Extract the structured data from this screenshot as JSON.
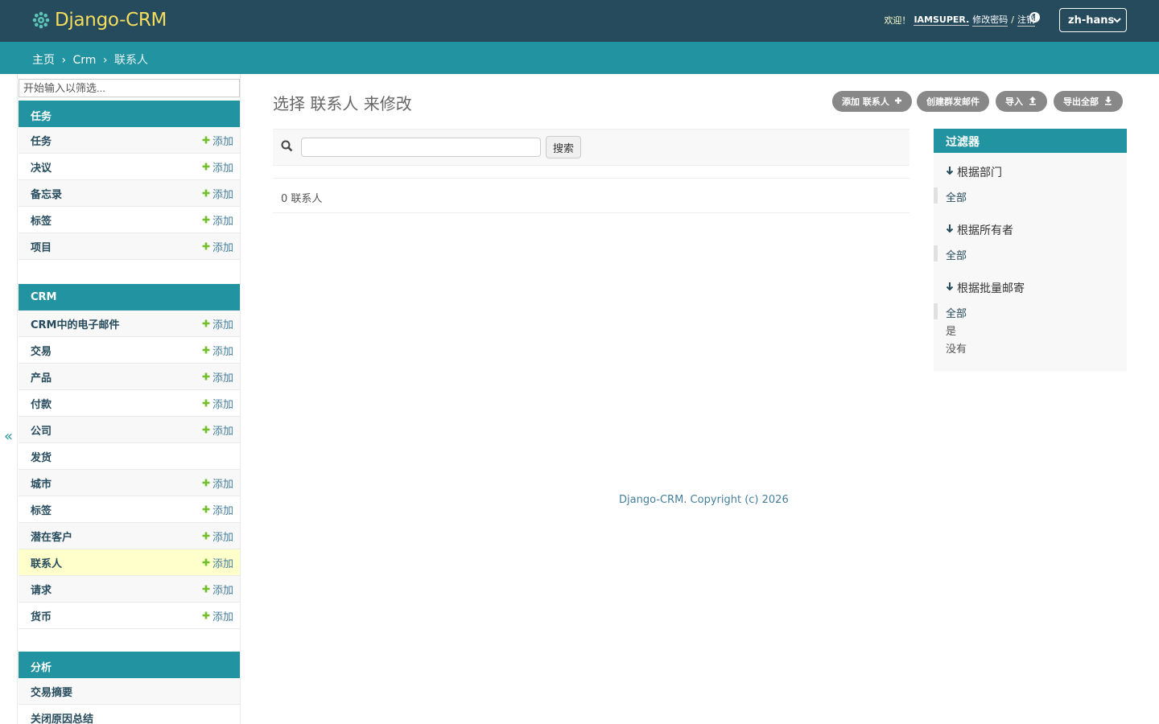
{
  "header": {
    "brand": "Django-CRM",
    "welcome": "欢迎！",
    "username": "IAMSUPER.",
    "change_password": "修改密码",
    "slash": "/",
    "logout": "注销",
    "language": "zh-hans"
  },
  "breadcrumbs": {
    "home": "主页",
    "app": "Crm",
    "current": "联系人",
    "sep": "›"
  },
  "sidebar": {
    "filter_placeholder": "开始输入以筛选...",
    "collapse": "«",
    "add_label": "添加",
    "modules": [
      {
        "caption": "任务",
        "items": [
          {
            "name": "任务",
            "add": true
          },
          {
            "name": "决议",
            "add": true
          },
          {
            "name": "备忘录",
            "add": true
          },
          {
            "name": "标签",
            "add": true
          },
          {
            "name": "项目",
            "add": true
          }
        ]
      },
      {
        "caption": "CRM",
        "items": [
          {
            "name": "CRM中的电子邮件",
            "add": true
          },
          {
            "name": "交易",
            "add": true
          },
          {
            "name": "产品",
            "add": true
          },
          {
            "name": "付款",
            "add": true
          },
          {
            "name": "公司",
            "add": true
          },
          {
            "name": "发货",
            "add": false
          },
          {
            "name": "城市",
            "add": true
          },
          {
            "name": "标签",
            "add": true
          },
          {
            "name": "潜在客户",
            "add": true
          },
          {
            "name": "联系人",
            "add": true,
            "current": true
          },
          {
            "name": "请求",
            "add": true
          },
          {
            "name": "货币",
            "add": true
          }
        ]
      },
      {
        "caption": "分析",
        "items": [
          {
            "name": "交易摘要",
            "add": false
          },
          {
            "name": "关闭原因总结",
            "add": false
          }
        ]
      }
    ]
  },
  "content": {
    "title": "选择 联系人 来修改",
    "tools": {
      "add": "添加 联系人",
      "mass_mail": "创建群发邮件",
      "import": "导入",
      "export": "导出全部"
    },
    "search_button": "搜索",
    "result_count": "0 联系人",
    "footer": "Django-CRM. Copyright (c) 2026"
  },
  "filter": {
    "title": "过滤器",
    "sections": [
      {
        "title": "根据部门",
        "options": [
          "全部"
        ],
        "selected": 0
      },
      {
        "title": "根据所有者",
        "options": [
          "全部"
        ],
        "selected": 0
      },
      {
        "title": "根据批量邮寄",
        "options": [
          "全部",
          "是",
          "没有"
        ],
        "selected": 0
      }
    ]
  },
  "colors": {
    "header": "#264b5d",
    "breadcrumb": "#2293a0",
    "brand": "#f5dd5d",
    "add_plus": "#70bf2b",
    "current_row": "#ffffcc"
  }
}
